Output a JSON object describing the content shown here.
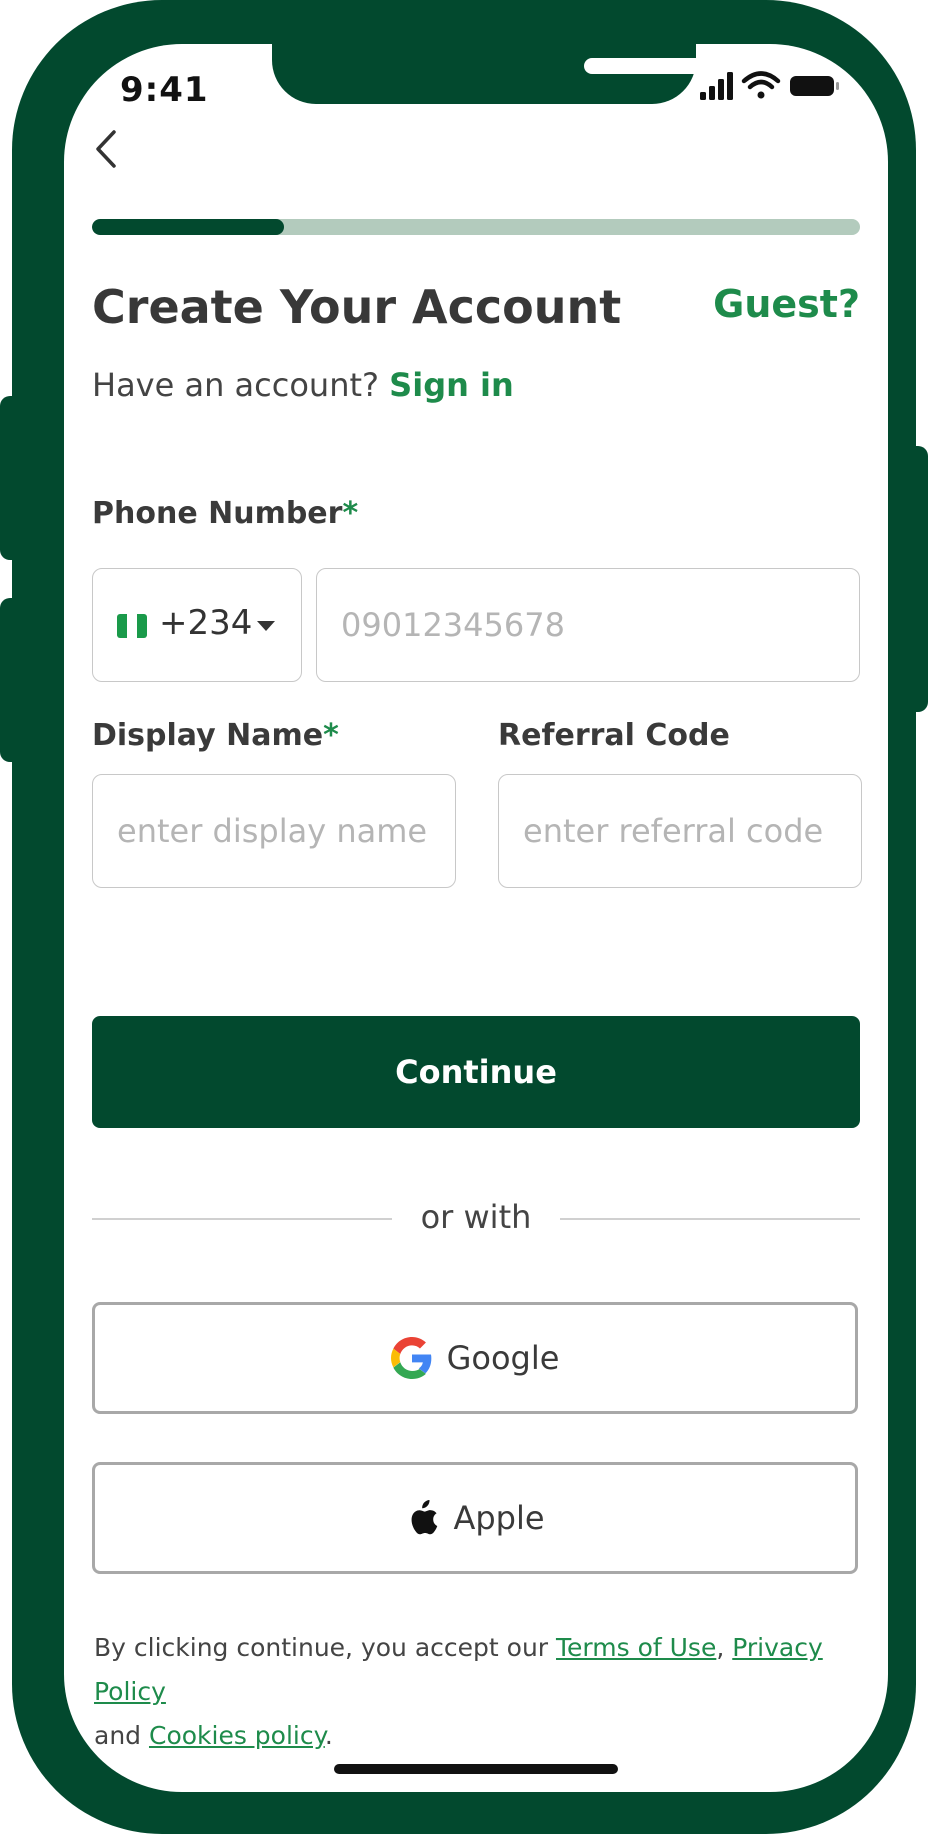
{
  "status_bar": {
    "time": "9:41"
  },
  "progress": {
    "fraction": 0.25
  },
  "header": {
    "title": "Create Your Account",
    "guest_link": "Guest?",
    "have_account_text": "Have an account?",
    "sign_in_link": "Sign in"
  },
  "form": {
    "phone": {
      "label": "Phone Number",
      "required_mark": "*",
      "country_code": "+234",
      "placeholder": "09012345678"
    },
    "display_name": {
      "label": "Display Name",
      "required_mark": "*",
      "placeholder": "enter display name"
    },
    "referral_code": {
      "label": "Referral Code",
      "placeholder": "enter referral code"
    }
  },
  "actions": {
    "continue_label": "Continue",
    "divider_text": "or with",
    "google_label": "Google",
    "apple_label": "Apple"
  },
  "legal": {
    "prefix": "By clicking continue, you accept our ",
    "terms": "Terms of Use",
    "comma": ",",
    "privacy": "Privacy Policy",
    "and": "and ",
    "cookies": "Cookies policy",
    "period": "."
  },
  "colors": {
    "brand_dark": "#02492e",
    "brand_green": "#1e8b4b",
    "progress_track": "#b3cbbd"
  },
  "icons": {
    "back": "chevron-left-icon",
    "flag": "nigeria-flag-icon",
    "dropdown": "caret-down-icon",
    "google": "google-icon",
    "apple": "apple-icon"
  }
}
